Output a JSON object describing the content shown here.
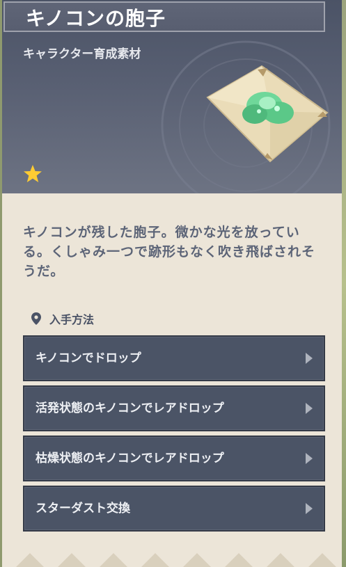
{
  "item": {
    "name": "キノコンの胞子",
    "category": "キャラクター育成素材",
    "rarity": 1,
    "description": "キノコンが残した胞子。微かな光を放っている。くしゃみ一つで跡形もなく吹き飛ばされそうだ。"
  },
  "sources": {
    "header_label": "入手方法",
    "items": [
      {
        "label": "キノコンでドロップ"
      },
      {
        "label": "活発状態のキノコンでレアドロップ"
      },
      {
        "label": "枯燥状態のキノコンでレアドロップ"
      },
      {
        "label": "スターダスト交換"
      }
    ]
  },
  "icons": {
    "rarity": "star-icon",
    "source": "map-pin-icon",
    "row_arrow": "chevron-right-icon"
  },
  "colors": {
    "header_bg": "#596073",
    "card_bg": "#ece5d8",
    "star": "#ffcc33",
    "text_muted": "#5c6477",
    "button_bg": "#4b5466"
  }
}
